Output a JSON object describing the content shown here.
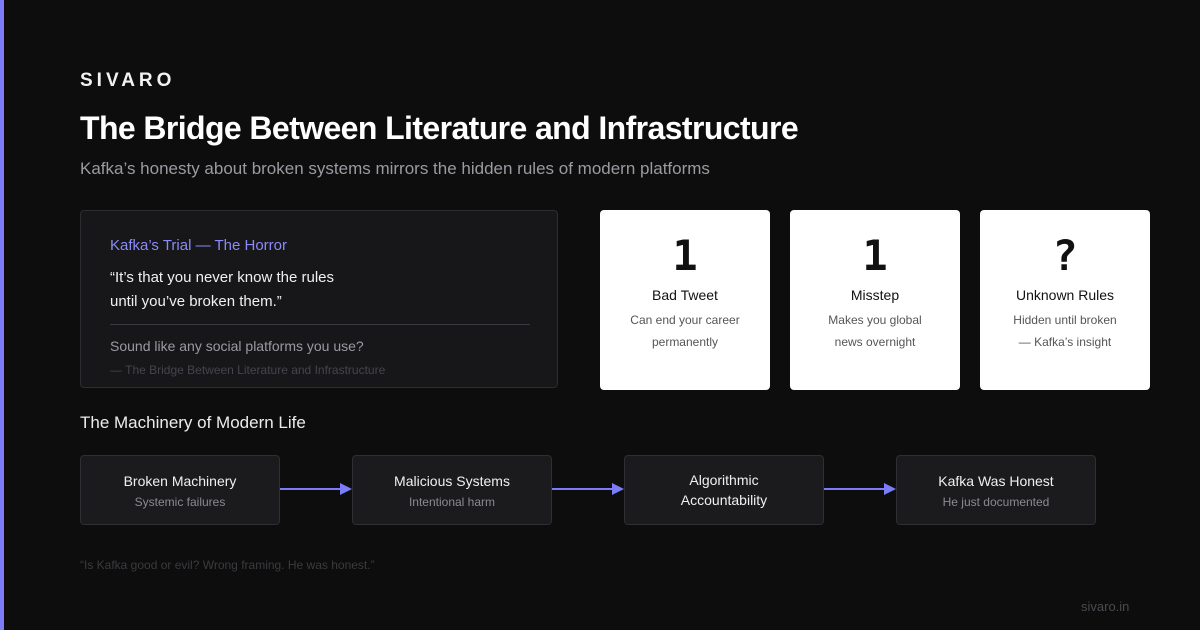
{
  "brand": "SIVARO",
  "title": "The Bridge Between Literature and Infrastructure",
  "subtitle": "Kafka’s honesty about broken systems mirrors the hidden rules of modern platforms",
  "quote_card": {
    "label": "Kafka’s Trial — The Horror",
    "quote_line1": "“It’s that you never know the rules",
    "quote_line2": "until you’ve broken them.”",
    "question": "Sound like any social platforms you use?",
    "source": "— The Bridge Between Literature and Infrastructure"
  },
  "stats": [
    {
      "value": "1",
      "label": "Bad Tweet",
      "desc_line1": "Can end your career",
      "desc_line2": "permanently"
    },
    {
      "value": "1",
      "label": "Misstep",
      "desc_line1": "Makes you global",
      "desc_line2": "news overnight"
    },
    {
      "value": "?",
      "label": "Unknown Rules",
      "desc_line1": "Hidden until broken",
      "desc_line2": "— Kafka’s insight"
    }
  ],
  "section_title": "The Machinery of Modern Life",
  "flow": [
    {
      "title": "Broken Machinery",
      "subtitle": "Systemic failures"
    },
    {
      "title": "Malicious Systems",
      "subtitle": "Intentional harm"
    },
    {
      "title": "Algorithmic Accountability",
      "subtitle": ""
    },
    {
      "title": "Kafka Was Honest",
      "subtitle": "He just documented"
    }
  ],
  "footer_quote": "“Is Kafka good or evil? Wrong framing. He was honest.”",
  "footer_site": "sivaro.in",
  "colors": {
    "background": "#0d0d0d",
    "accent": "#7c7cf8",
    "card_dark": "#17171a",
    "card_light": "#ffffff"
  },
  "icons": [
    "right-arrow-icon"
  ]
}
